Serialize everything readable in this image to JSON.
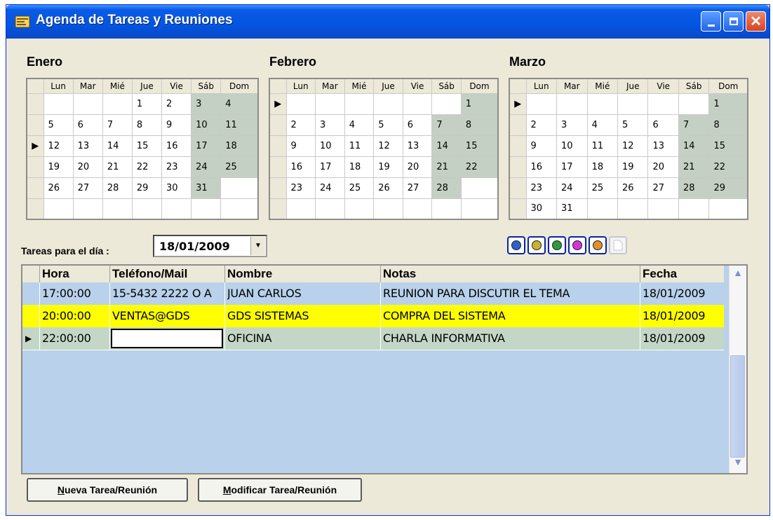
{
  "window": {
    "title": "Agenda de Tareas y Reuniones"
  },
  "calendars": [
    {
      "month": "Enero",
      "headers": [
        "Lun",
        "Mar",
        "Mié",
        "Jue",
        "Vie",
        "Sáb",
        "Dom"
      ],
      "weeks": [
        {
          "indicator": "",
          "days": [
            "",
            "",
            "",
            "1",
            "2",
            "3",
            "4"
          ]
        },
        {
          "indicator": "",
          "days": [
            "5",
            "6",
            "7",
            "8",
            "9",
            "10",
            "11"
          ]
        },
        {
          "indicator": "▶",
          "days": [
            "12",
            "13",
            "14",
            "15",
            "16",
            "17",
            "18"
          ]
        },
        {
          "indicator": "",
          "days": [
            "19",
            "20",
            "21",
            "22",
            "23",
            "24",
            "25"
          ]
        },
        {
          "indicator": "",
          "days": [
            "26",
            "27",
            "28",
            "29",
            "30",
            "31",
            ""
          ]
        },
        {
          "indicator": "",
          "days": [
            "",
            "",
            "",
            "",
            "",
            "",
            ""
          ]
        }
      ]
    },
    {
      "month": "Febrero",
      "headers": [
        "Lun",
        "Mar",
        "Mié",
        "Jue",
        "Vie",
        "Sáb",
        "Dom"
      ],
      "weeks": [
        {
          "indicator": "▶",
          "days": [
            "",
            "",
            "",
            "",
            "",
            "",
            "1"
          ]
        },
        {
          "indicator": "",
          "days": [
            "2",
            "3",
            "4",
            "5",
            "6",
            "7",
            "8"
          ]
        },
        {
          "indicator": "",
          "days": [
            "9",
            "10",
            "11",
            "12",
            "13",
            "14",
            "15"
          ]
        },
        {
          "indicator": "",
          "days": [
            "16",
            "17",
            "18",
            "19",
            "20",
            "21",
            "22"
          ]
        },
        {
          "indicator": "",
          "days": [
            "23",
            "24",
            "25",
            "26",
            "27",
            "28",
            ""
          ]
        },
        {
          "indicator": "",
          "days": [
            "",
            "",
            "",
            "",
            "",
            "",
            ""
          ]
        }
      ]
    },
    {
      "month": "Marzo",
      "headers": [
        "Lun",
        "Mar",
        "Mié",
        "Jue",
        "Vie",
        "Sáb",
        "Dom"
      ],
      "weeks": [
        {
          "indicator": "▶",
          "days": [
            "",
            "",
            "",
            "",
            "",
            "",
            "1"
          ]
        },
        {
          "indicator": "",
          "days": [
            "2",
            "3",
            "4",
            "5",
            "6",
            "7",
            "8"
          ]
        },
        {
          "indicator": "",
          "days": [
            "9",
            "10",
            "11",
            "12",
            "13",
            "14",
            "15"
          ]
        },
        {
          "indicator": "",
          "days": [
            "16",
            "17",
            "18",
            "19",
            "20",
            "21",
            "22"
          ]
        },
        {
          "indicator": "",
          "days": [
            "23",
            "24",
            "25",
            "26",
            "27",
            "28",
            "29"
          ]
        },
        {
          "indicator": "",
          "days": [
            "30",
            "31",
            "",
            "",
            "",
            "",
            ""
          ]
        }
      ]
    }
  ],
  "tasks": {
    "label": "Tareas para el día :",
    "date": "18/01/2009",
    "color_buttons": [
      "#2f63c9",
      "#c9b22f",
      "#2f9a3a",
      "#d633d6",
      "#e0912a"
    ],
    "columns": [
      "Hora",
      "Teléfono/Mail",
      "Nombre",
      "Notas",
      "Fecha"
    ],
    "rows": [
      {
        "indicator": "",
        "hora": "17:00:00",
        "contacto": "15-5432 2222 O A",
        "nombre": "JUAN CARLOS",
        "notas": "REUNION PARA DISCUTIR EL TEMA",
        "fecha": "18/01/2009",
        "color": "#b9d1ea"
      },
      {
        "indicator": "",
        "hora": "20:00:00",
        "contacto": "VENTAS@GDS",
        "nombre": "GDS SISTEMAS",
        "notas": "COMPRA DEL SISTEMA",
        "fecha": "18/01/2009",
        "color": "#ffff00"
      },
      {
        "indicator": "▶",
        "hora": "22:00:00",
        "contacto": "",
        "nombre": "OFICINA",
        "notas": "CHARLA INFORMATIVA",
        "fecha": "18/01/2009",
        "color": "#c4d7c7"
      }
    ]
  },
  "buttons": {
    "nueva": "Nueva Tarea/Reunión",
    "modificar": "Modificar Tarea/Reunión"
  }
}
